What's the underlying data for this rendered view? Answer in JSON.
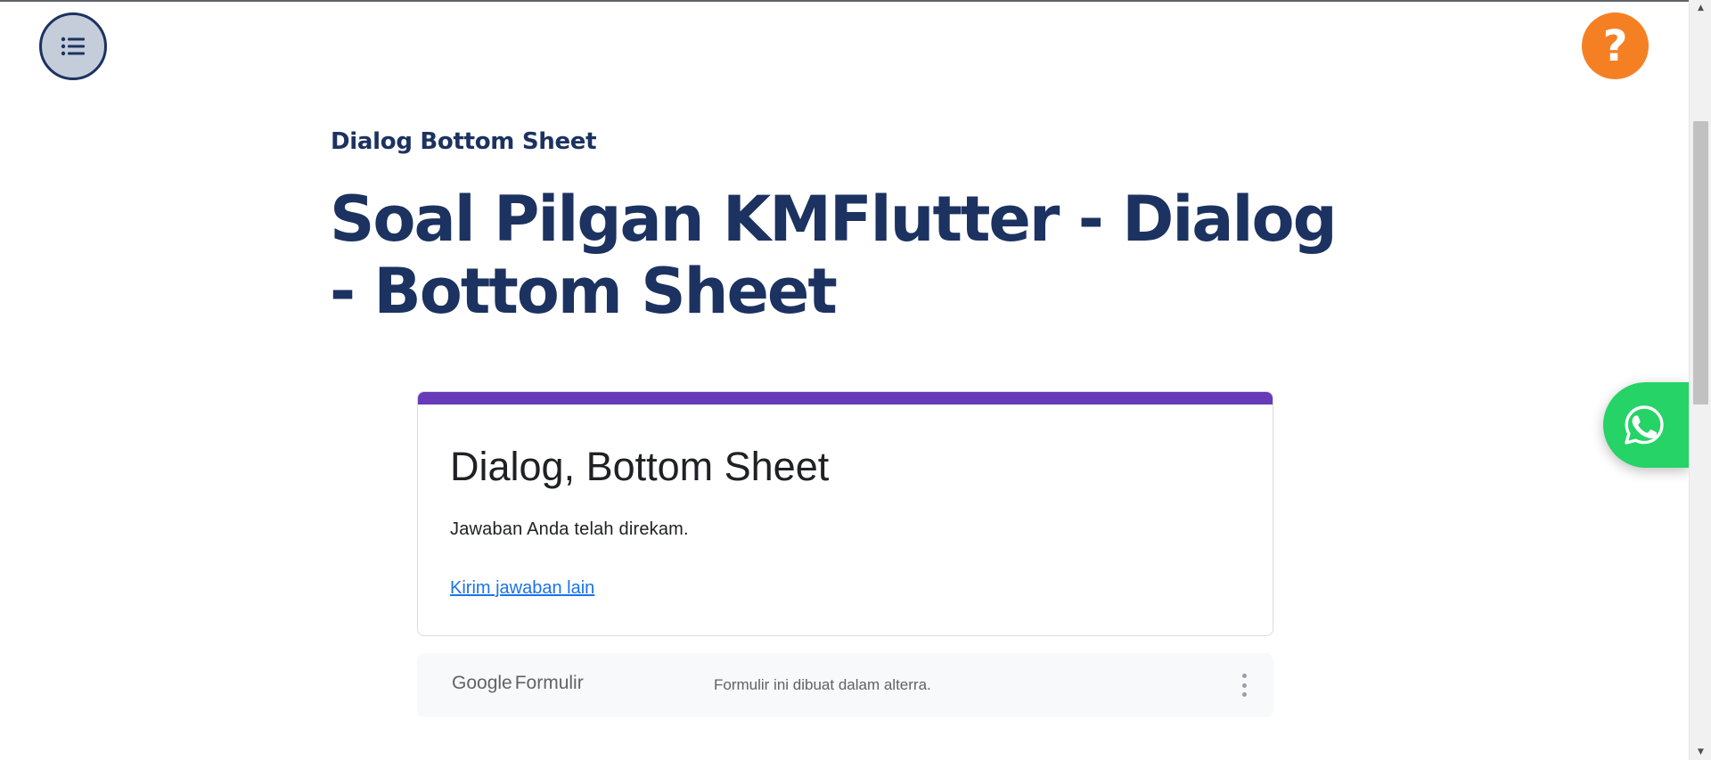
{
  "breadcrumb": "Dialog Bottom Sheet",
  "page_title": "Soal Pilgan KMFlutter - Dialog - Bottom Sheet",
  "form": {
    "title": "Dialog, Bottom Sheet",
    "message": "Jawaban Anda telah direkam.",
    "link_label": "Kirim jawaban lain",
    "accent_color": "#673ab7"
  },
  "footer": {
    "logo_google": "Google",
    "logo_product": "Formulir",
    "note": "Formulir ini dibuat dalam alterra."
  },
  "buttons": {
    "help_label": "?",
    "toc_icon": "list-icon",
    "whatsapp_icon": "whatsapp-icon"
  },
  "colors": {
    "heading": "#1c3260",
    "help": "#f58024",
    "whatsapp": "#25d366",
    "link": "#1a73e8"
  }
}
